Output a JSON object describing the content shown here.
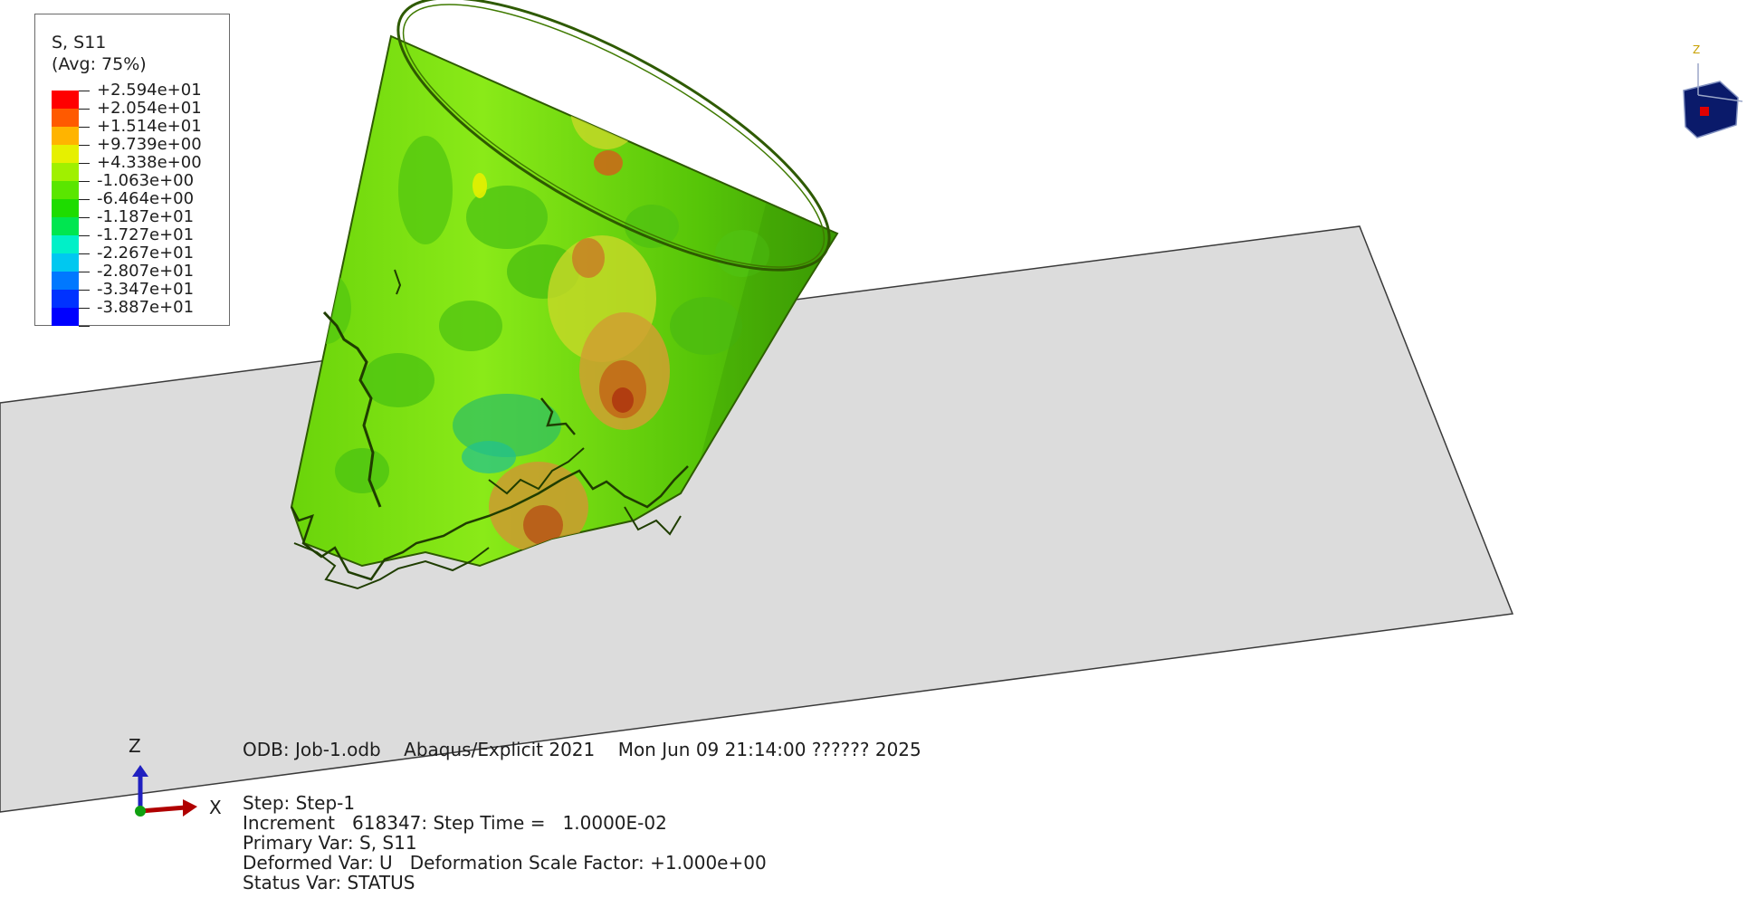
{
  "legend": {
    "title": "S, S11",
    "avg": "(Avg: 75%)",
    "entries": [
      {
        "value": "+2.594e+01",
        "color": "#ff0000"
      },
      {
        "value": "+2.054e+01",
        "color": "#ff5a00"
      },
      {
        "value": "+1.514e+01",
        "color": "#ffb400"
      },
      {
        "value": "+9.739e+00",
        "color": "#e6f000"
      },
      {
        "value": "+4.338e+00",
        "color": "#a0f000"
      },
      {
        "value": "-1.063e+00",
        "color": "#5ae600"
      },
      {
        "value": "-6.464e+00",
        "color": "#1edc00"
      },
      {
        "value": "-1.187e+01",
        "color": "#00e650"
      },
      {
        "value": "-1.727e+01",
        "color": "#00f0c8"
      },
      {
        "value": "-2.267e+01",
        "color": "#00c8f0"
      },
      {
        "value": "-2.807e+01",
        "color": "#0078ff"
      },
      {
        "value": "-3.347e+01",
        "color": "#0032ff"
      },
      {
        "value": "-3.887e+01",
        "color": "#0000ff"
      }
    ]
  },
  "info": {
    "odb": "ODB: Job-1.odb",
    "solver": "Abaqus/Explicit 2021",
    "datetime": "Mon Jun 09 21:14:00 ?????? 2025",
    "step": "Step: Step-1",
    "increment_label": "Increment",
    "increment_value": "618347: Step Time =",
    "step_time": "1.0000E-02",
    "primary_var": "Primary Var: S, S11",
    "deformed_var": "Deformed Var: U",
    "scale_factor": "Deformation Scale Factor: +1.000e+00",
    "status_var": "Status Var: STATUS"
  },
  "triad": {
    "z": "Z",
    "x": "X",
    "z_small": "Z"
  },
  "colors": {
    "plate": "#dcdcdc",
    "outline": "#3a3a3a",
    "shell_base": "#7fe010",
    "shell_dark": "#3fb000"
  }
}
